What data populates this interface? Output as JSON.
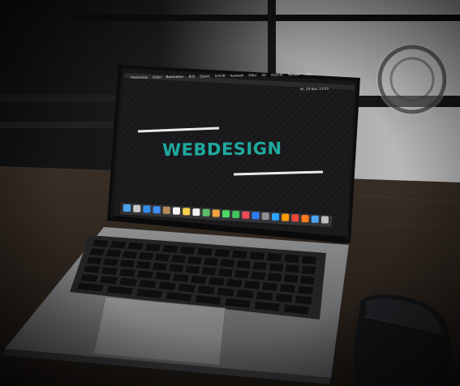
{
  "screen": {
    "headline": "WEBDESIGN",
    "menubar": {
      "items": [
        "Photoshop",
        "Datei",
        "Bearbeiten",
        "Bild",
        "Ebene",
        "Schrift",
        "Auswahl",
        "Filter",
        "3D",
        "Ansicht",
        "Fenster",
        "Hilfe"
      ],
      "clock": "Mi. 29 Nov. 13:53"
    },
    "accent_color": "#1fa99e"
  },
  "dock": {
    "icons": [
      "finder-icon",
      "launchpad-icon",
      "safari-icon",
      "mail-icon",
      "contacts-icon",
      "calendar-icon",
      "notes-icon",
      "reminders-icon",
      "maps-icon",
      "photos-icon",
      "messages-icon",
      "facetime-icon",
      "music-icon",
      "app-store-icon",
      "settings-icon",
      "photoshop-icon",
      "illustrator-icon",
      "chrome-icon",
      "firefox-icon",
      "finder-folder-icon",
      "trash-icon"
    ]
  }
}
